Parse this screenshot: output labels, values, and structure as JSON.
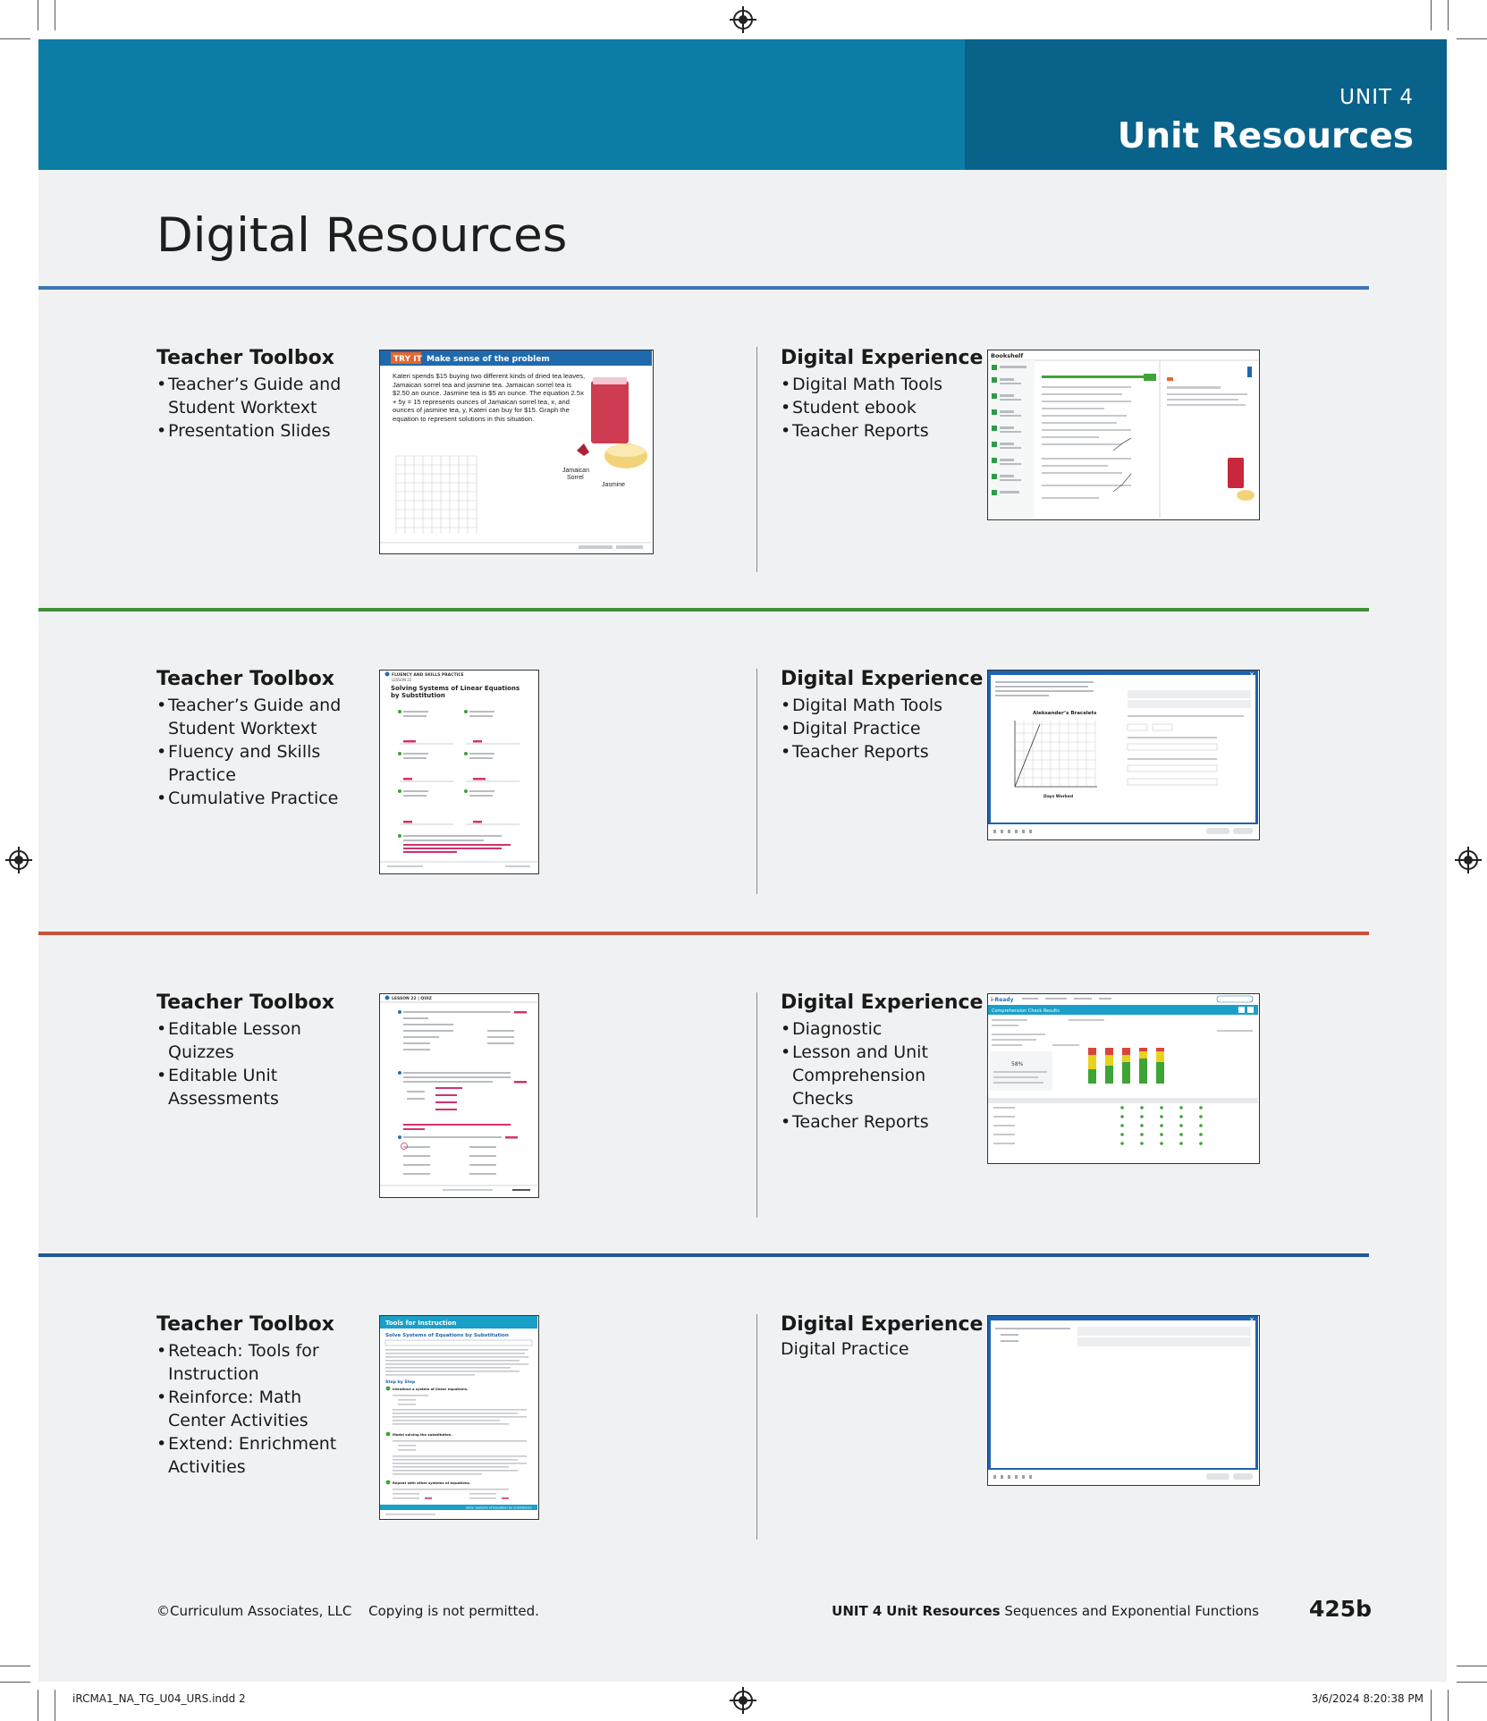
{
  "header": {
    "unit_label": "UNIT 4",
    "unit_title": "Unit Resources"
  },
  "page_title": "Digital Resources",
  "colors": {
    "banner_left": "#0c7ea6",
    "banner_right": "#08628a",
    "rule_1": "#3b74b8",
    "rule_2": "#3e8f36",
    "rule_3": "#c8513a",
    "rule_4": "#235891"
  },
  "rows": [
    {
      "toolbox_title": "Teacher Toolbox",
      "toolbox_items": [
        "Teacher’s Guide and Student Worktext",
        "Presentation Slides"
      ],
      "toolbox_thumb": {
        "kind": "slide",
        "badge": "TRY IT",
        "heading": "Make sense of the problem",
        "body": "Kateri spends $15 buying two different kinds of dried tea leaves, Jamaican sorrel tea and jasmine tea. Jamaican sorrel tea is $2.50 an ounce. Jasmine tea is $5 an ounce. The equation 2.5x + 5y = 15 represents ounces of Jamaican sorrel tea, x, and ounces of jasmine tea, y, Kateri can buy for $15. Graph the equation to represent solutions in this situation.",
        "label_sorrel_1": "Jamaican",
        "label_sorrel_2": "Sorrel",
        "label_jasmine": "Jasmine"
      },
      "digital_title": "Digital Experience",
      "digital_items": [
        "Digital Math Tools",
        "Student ebook",
        "Teacher Reports"
      ],
      "digital_thumb": {
        "kind": "ebook",
        "label": "Bookshelf"
      }
    },
    {
      "toolbox_title": "Teacher Toolbox",
      "toolbox_items": [
        "Teacher’s Guide and Student Worktext",
        "Fluency and Skills Practice",
        "Cumulative Practice"
      ],
      "toolbox_thumb": {
        "kind": "worksheet",
        "eyebrow": "FLUENCY AND SKILLS PRACTICE",
        "lesson": "LESSON 22",
        "heading": "Solving Systems of Linear Equations by Substitution"
      },
      "digital_title": "Digital Experience",
      "digital_items": [
        "Digital Math Tools",
        "Digital Practice",
        "Teacher Reports"
      ],
      "digital_thumb": {
        "kind": "practice-graph",
        "graph_title": "Aleksander’s Bracelets",
        "x_label": "Days Worked"
      }
    },
    {
      "toolbox_title": "Teacher Toolbox",
      "toolbox_items": [
        "Editable Lesson Quizzes",
        "Editable Unit Assessments"
      ],
      "toolbox_thumb": {
        "kind": "quiz",
        "eyebrow": "LESSON 22 | QUIZ"
      },
      "digital_title": "Digital Experience",
      "digital_items": [
        "Diagnostic",
        "Lesson and Unit Comprehension Checks",
        "Teacher Reports"
      ],
      "digital_thumb": {
        "kind": "report",
        "brand": "i-Ready",
        "bar_title": "Comprehension Check Results",
        "score": "58%",
        "chart_data": {
          "type": "bar",
          "stacked": true,
          "categories": [
            "1",
            "2",
            "3",
            "4",
            "5"
          ],
          "series": [
            {
              "color": "#3da435",
              "values": [
                4,
                5,
                6,
                7,
                6
              ]
            },
            {
              "color": "#e8d21e",
              "values": [
                4,
                3,
                2,
                2,
                3
              ]
            },
            {
              "color": "#d9443d",
              "values": [
                2,
                2,
                2,
                1,
                1
              ]
            }
          ]
        }
      }
    },
    {
      "toolbox_title": "Teacher Toolbox",
      "toolbox_items": [
        "Reteach: Tools for Instruction",
        "Reinforce: Math Center Activities",
        "Extend: Enrichment Activities"
      ],
      "toolbox_thumb": {
        "kind": "tools",
        "bar": "Tools for Instruction",
        "heading": "Solve Systems of Equations by Substitution",
        "step_label": "Step by Step",
        "footer_bar": "Solve Systems of Equations by Substitution",
        "steps": [
          "Introduce a system of linear equations.",
          "Model solving the substitution.",
          "Repeat with other systems of equations."
        ]
      },
      "digital_title": "Digital Experience",
      "digital_line": "Digital Practice",
      "digital_thumb": {
        "kind": "practice-blank"
      }
    }
  ],
  "footer": {
    "copyright": "©Curriculum Associates, LLC",
    "notice": "Copying is not permitted.",
    "unit": "UNIT 4",
    "section": "Unit Resources",
    "topic": "Sequences and Exponential Functions",
    "page_number": "425b"
  },
  "slug": {
    "file": "iRCMA1_NA_TG_U04_URS.indd   2",
    "timestamp": "3/6/2024   8:20:38 PM"
  }
}
